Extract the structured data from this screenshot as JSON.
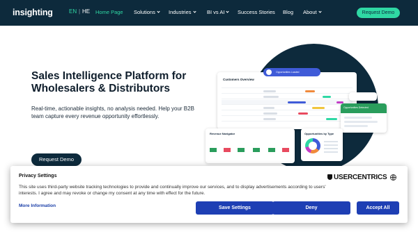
{
  "nav": {
    "logo": "insighting",
    "lang_en": "EN",
    "lang_sep": "|",
    "lang_he": "HE",
    "items": [
      {
        "label": "Home Page"
      },
      {
        "label": "Solutions"
      },
      {
        "label": "Industries"
      },
      {
        "label": "BI vs AI"
      },
      {
        "label": "Success Stories"
      },
      {
        "label": "Blog"
      },
      {
        "label": "About"
      }
    ],
    "cta": "Request Demo"
  },
  "hero": {
    "title": "Sales Intelligence Platform for Wholesalers & Distributors",
    "subtitle": "Real-time, actionable insights, no analysis needed. Help your B2B team capture every revenue opportunity effortlessly.",
    "cta": "Request Demo"
  },
  "illustration": {
    "main_card_title": "Customers Overview",
    "pill_text": "Opportunities Loaded",
    "revenue_title": "Revenue Navigator",
    "opp_title": "Opportunities by Type",
    "green_card_text": "Opportunities Detected"
  },
  "consent": {
    "title": "Privacy Settings",
    "text": "This site uses third-party website tracking technologies to provide and continually improve our services, and to display advertisements according to users' interests. I agree and may revoke or change my consent at any time with effect for the future.",
    "more": "More Information",
    "brand": "USERCENTRICS",
    "save": "Save Settings",
    "deny": "Deny",
    "accept": "Accept All"
  },
  "colors": {
    "nav_bg": "#0d2a3c",
    "accent": "#2fd8a4",
    "button_blue": "#1e3fb4"
  }
}
